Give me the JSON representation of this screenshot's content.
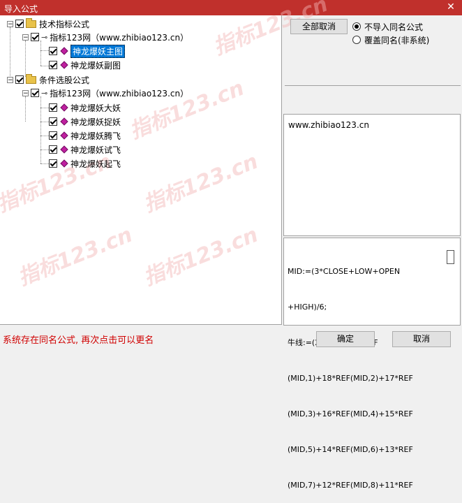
{
  "window": {
    "title": "导入公式",
    "close_glyph": "✕"
  },
  "tree": {
    "nodes": [
      {
        "label": "技术指标公式",
        "level": 0
      },
      {
        "label": "指标123网（www.zhibiao123.cn）",
        "level": 1
      },
      {
        "label": "神龙爆妖主图",
        "level": 2,
        "selected": true
      },
      {
        "label": "神龙爆妖副图",
        "level": 2
      },
      {
        "label": "条件选股公式",
        "level": 0
      },
      {
        "label": "指标123网（www.zhibiao123.cn）",
        "level": 1
      },
      {
        "label": "神龙爆妖大妖",
        "level": 2
      },
      {
        "label": "神龙爆妖捉妖",
        "level": 2
      },
      {
        "label": "神龙爆妖腾飞",
        "level": 2
      },
      {
        "label": "神龙爆妖试飞",
        "level": 2
      },
      {
        "label": "神龙爆妖起飞",
        "level": 2
      }
    ],
    "watermark": "指标123.cn"
  },
  "options": {
    "deselect_all_label": "全部取消",
    "radio_no_import_label": "不导入同名公式",
    "radio_overwrite_label": "覆盖同名(非系统)",
    "selected": "no_import"
  },
  "info_panel": {
    "text": "www.zhibiao123.cn"
  },
  "code_panel": {
    "lines": [
      "MID:=(3*CLOSE+LOW+OPEN",
      "+HIGH)/6;",
      "牛线:=(20*MID+19*REF",
      "(MID,1)+18*REF(MID,2)+17*REF",
      "(MID,3)+16*REF(MID,4)+15*REF",
      "(MID,5)+14*REF(MID,6)+13*REF",
      "(MID,7)+12*REF(MID,8)+11*REF"
    ]
  },
  "status": {
    "message": "系统存在同名公式, 再次点击可以更名"
  },
  "footer": {
    "ok_label": "确定",
    "cancel_label": "取消"
  },
  "colors": {
    "titlebar": "#c0302c",
    "status_text": "#d00000",
    "selection": "#0078d7"
  }
}
